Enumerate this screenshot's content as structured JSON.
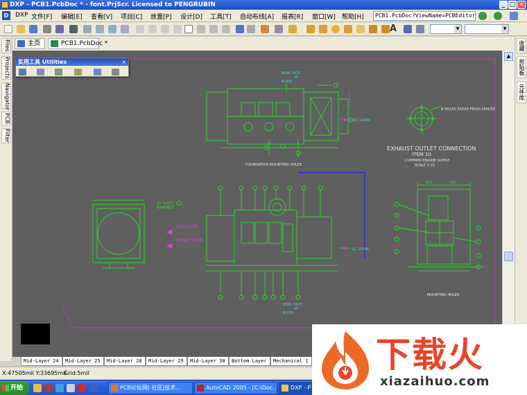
{
  "window": {
    "title": "DXP - PCB1.PcbDoc * - font.PrjScr. Licensed to PENGRUBIN"
  },
  "menu": {
    "items": [
      "DXP",
      "文件[F]",
      "编辑[E]",
      "查看[V]",
      "项目[C]",
      "放置[P]",
      "设计[D]",
      "工具[T]",
      "自动布线[A]",
      "报表[R]",
      "窗口[W]",
      "帮助[H]"
    ],
    "address": "PCB1.PcbDoc?ViewName=PCBEditor."
  },
  "tabs": {
    "home": "主页",
    "doc": "PCB1.PcbDoc *"
  },
  "left_panels": [
    "Files",
    "Projects",
    "Navigator",
    "PCB",
    "Filter"
  ],
  "right_panels": [
    "收藏",
    "剪贴板",
    "元件库"
  ],
  "utilities": {
    "title": "实用工具 Utilities",
    "close": "×"
  },
  "drawing": {
    "read_face_top": [
      "READ FACE",
      "OF",
      "BLOCK"
    ],
    "read_face_bottom": [
      "READ FACE",
      "OF",
      "BLOCK"
    ],
    "cl_crank_top": "CL CRANK",
    "cl_crank_bottom": "CL CRANK",
    "foundation": "FOUNDATION MOUNTING HOLES",
    "holes_note": "8 HOLES 2XXXX FEQUI-SPACED",
    "exhaust": [
      "EXHAUST OUTLET CONNECTION",
      "ITEM 10",
      "CUMMINS ENGINE SUPPLY",
      "SCALE 1:10"
    ],
    "dim_left": "670",
    "dim_right": "670",
    "airflow": [
      "AIRFLOW",
      "DIRECTION"
    ],
    "slots": [
      "10 SLOTS",
      "MOVEABLE"
    ],
    "mounting_holes": "MOUNTING HOLES"
  },
  "layers": [
    "Mid-Layer 24",
    "Mid-Layer 25",
    "Mid-Layer 28",
    "Mid-Layer 29",
    "Mid-Layer 30",
    "Bottom Layer",
    "Mechanical 1"
  ],
  "status": {
    "coords": "X:47505mil Y:33695mil",
    "grid": "Grid:5mil"
  },
  "taskbar": {
    "start": "开始",
    "tasks": [
      "PCB论坛网( 社区|技术...",
      "AutoCAD 2005 - [C:\\Doc...",
      "DXP - P"
    ]
  },
  "watermark": {
    "big": "下载火",
    "url": "xiazaihuo.com"
  },
  "colors": {
    "canvas": "#5f5f5f",
    "cad_green": "#28d428",
    "board_outline": "#b040c0",
    "route_blue": "#2030e0",
    "brand": "#e8452a"
  }
}
